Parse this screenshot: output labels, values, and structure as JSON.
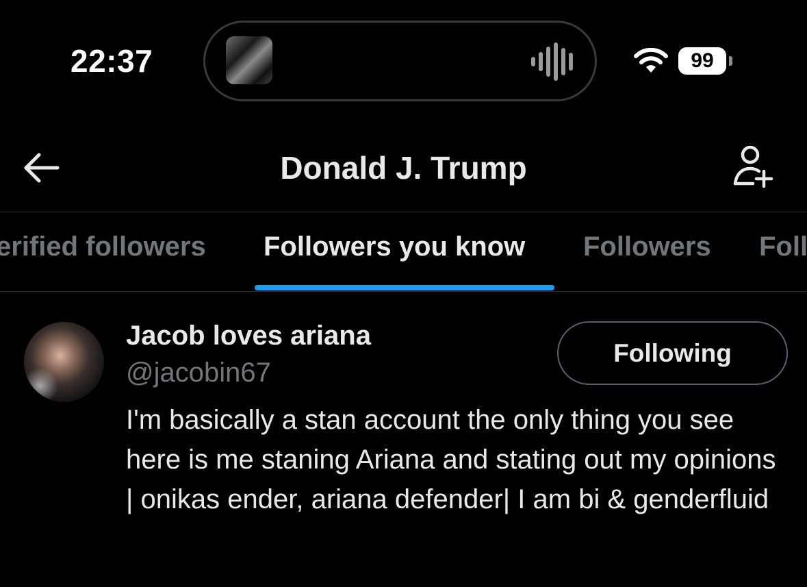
{
  "status_bar": {
    "time": "22:37",
    "battery": "99",
    "wifi_icon": "wifi-icon",
    "now_playing_icon": "waveform-icon"
  },
  "header": {
    "title": "Donald J. Trump",
    "back_icon": "arrow-left-icon",
    "add_icon": "add-user-icon"
  },
  "tabs": [
    {
      "label": "erified followers",
      "active": false
    },
    {
      "label": "Followers you know",
      "active": true
    },
    {
      "label": "Followers",
      "active": false
    },
    {
      "label": "Foll",
      "active": false
    }
  ],
  "users": [
    {
      "display_name": "Jacob loves ariana",
      "handle": "@jacobin67",
      "follow_label": "Following",
      "bio": "I'm basically a stan account the only thing you see here is me staning Ariana and stating out my opinions | onikas ender, ariana defender| I am bi & genderfluid"
    }
  ],
  "colors": {
    "background": "#000000",
    "accent": "#1d9bf0",
    "text_primary": "#e7e9ea",
    "text_secondary": "#71767b"
  }
}
